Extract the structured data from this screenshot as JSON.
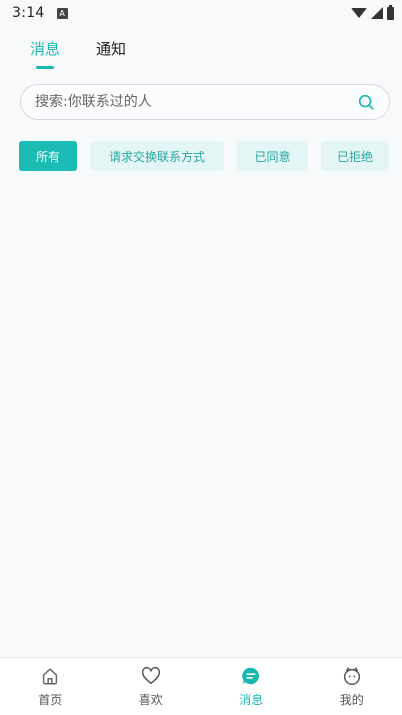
{
  "status_bar": {
    "time": "3:14",
    "notification_letter": "A"
  },
  "top_tabs": [
    {
      "label": "消息",
      "active": true
    },
    {
      "label": "通知",
      "active": false
    }
  ],
  "search": {
    "placeholder": "搜索:你联系过的人",
    "value": ""
  },
  "filters": [
    {
      "label": "所有",
      "active": true
    },
    {
      "label": "请求交换联系方式",
      "active": false
    },
    {
      "label": "已同意",
      "active": false
    },
    {
      "label": "已拒绝",
      "active": false
    }
  ],
  "bottom_nav": [
    {
      "label": "首页",
      "icon": "home-icon",
      "active": false
    },
    {
      "label": "喜欢",
      "icon": "heart-icon",
      "active": false
    },
    {
      "label": "消息",
      "icon": "message-icon",
      "active": true
    },
    {
      "label": "我的",
      "icon": "profile-icon",
      "active": false
    }
  ],
  "colors": {
    "accent": "#18b9b0",
    "chip_bg": "#e3f5f4",
    "background": "#f8f9fb"
  }
}
